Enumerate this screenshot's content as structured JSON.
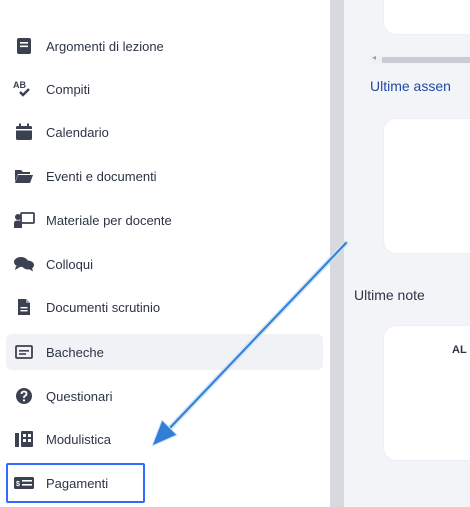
{
  "sidebar": {
    "items": [
      {
        "label": "Argomenti di lezione",
        "icon": "book-icon"
      },
      {
        "label": "Compiti",
        "icon": "spellcheck-icon"
      },
      {
        "label": "Calendario",
        "icon": "calendar-icon"
      },
      {
        "label": "Eventi e documenti",
        "icon": "folder-open-icon"
      },
      {
        "label": "Materiale per docente",
        "icon": "teacher-icon"
      },
      {
        "label": "Colloqui",
        "icon": "chat-icon"
      },
      {
        "label": "Documenti scrutinio",
        "icon": "document-icon"
      },
      {
        "label": "Bacheche",
        "icon": "board-icon"
      },
      {
        "label": "Questionari",
        "icon": "question-icon"
      },
      {
        "label": "Modulistica",
        "icon": "forms-icon"
      },
      {
        "label": "Pagamenti",
        "icon": "payment-card-icon"
      }
    ],
    "selected": "Bacheche",
    "highlighted": "Pagamenti"
  },
  "main": {
    "absences_title": "Ultime assen",
    "notes_title": "Ultime note",
    "notes_card_label": "AL"
  },
  "colors": {
    "accent": "#2f6bff",
    "title_blue": "#1f4aa6",
    "text": "#2c3445",
    "arrow": "#2f7fd8"
  }
}
